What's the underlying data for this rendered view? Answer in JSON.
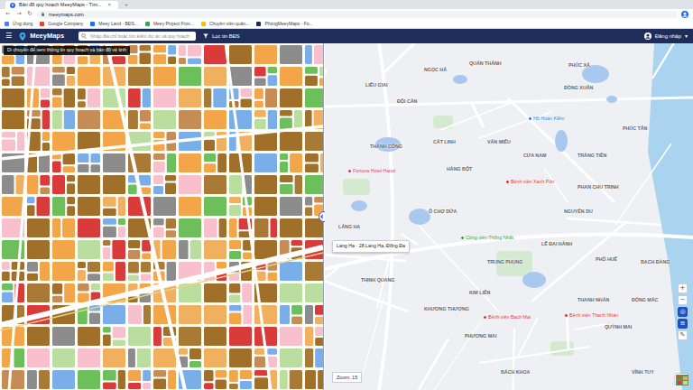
{
  "browser": {
    "tabs": [
      {
        "label": "Bản đồ quy hoạch MeeyMaps - Tìm...",
        "selected": true
      }
    ],
    "close": "×",
    "new_tab": "+",
    "nav": [
      "←",
      "→",
      "↻"
    ],
    "address": "meeymaps.com",
    "bookmarks": [
      "Ứng dụng",
      "Google Company",
      "Meey Land - BĐS...",
      "Meey Project Fron...",
      "Chuyên viên quản...",
      "PhòngMeeyMaps - Fo..."
    ]
  },
  "header": {
    "menu": "☰",
    "logo": "MeeyMaps",
    "search": {
      "placeholder": "Nhập địa chỉ hoặc tìm kiếm dự án và quy hoạch"
    },
    "filter": "Lọc tin BĐS",
    "login": "Đăng nhập",
    "caret": "▾"
  },
  "notice": "Di chuyển để xem thông tin quy hoạch và bản đồ vệ tinh",
  "map": {
    "labels": [
      "LIỄU GIAI",
      "NGỌC HÀ",
      "QUÁN THÁNH",
      "PHÚC XÁ",
      "ĐỘI CẤN",
      "ĐỒNG XUÂN",
      "PHÚC TÂN",
      "CÁT LINH",
      "VĂN MIẾU",
      "THÀNH CÔNG",
      "CỬA NAM",
      "TRÀNG TIỀN",
      "HÀNG BỘT",
      "PHAN CHU TRINH",
      "Ô CHỢ DỪA",
      "NGUYỄN DU",
      "LÁNG HẠ",
      "LÊ ĐẠI HÀNH",
      "PHỐ HUẾ",
      "TRUNG PHỤNG",
      "BẠCH ĐẰNG",
      "THỊNH QUANG",
      "KIM LIÊN",
      "THANH NHÀN",
      "ĐỐNG MÁC",
      "KHƯƠNG THƯỢNG",
      "QUỲNH MAI",
      "PHƯƠNG MAI",
      "BÁCH KHOA",
      "VĨNH TUY"
    ],
    "pois": [
      {
        "name": "Hồ Hoàn Kiếm",
        "color": "#2f7de1"
      },
      {
        "name": "Fortuna Hotel Hanoi",
        "color": "#d6336c"
      },
      {
        "name": "Bệnh viện Xanh Pôn",
        "color": "#e03131"
      },
      {
        "name": "Công viên Thống Nhất",
        "color": "#2f9e44"
      },
      {
        "name": "Bệnh viện Bạch Mai",
        "color": "#e03131"
      },
      {
        "name": "Bệnh viện Thanh Nhàn",
        "color": "#e03131"
      }
    ],
    "popup": "Láng Hạ · 28 Láng Hạ, Đống Đa",
    "zoom": "Zoom: 15",
    "controls": [
      {
        "label": "+",
        "selected": false
      },
      {
        "label": "−",
        "selected": false
      },
      {
        "label": "◎",
        "selected": true
      },
      {
        "label": "≡",
        "selected": true
      },
      {
        "label": "✎",
        "selected": false
      }
    ]
  }
}
